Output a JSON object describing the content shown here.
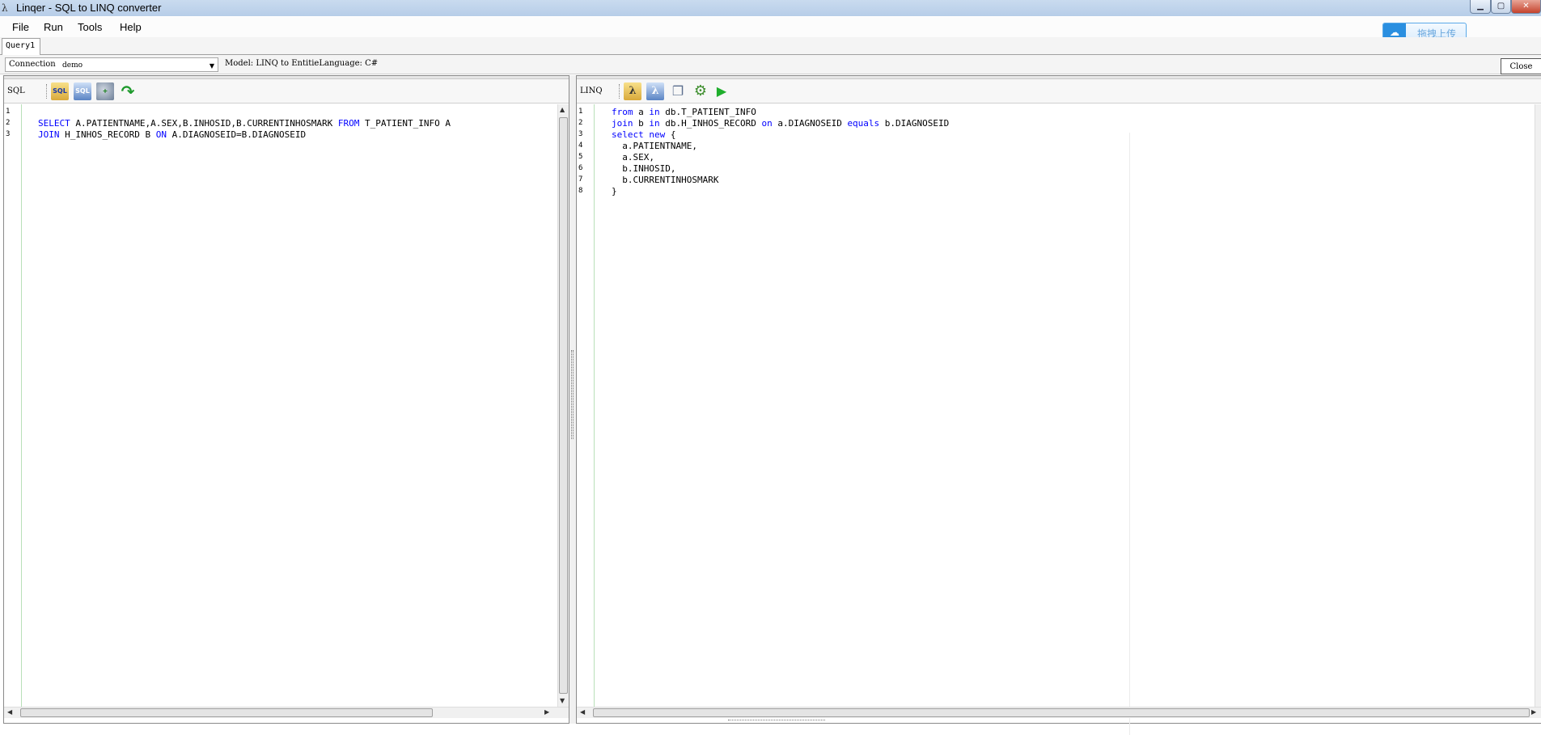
{
  "window": {
    "title": "Linqer - SQL to LINQ converter",
    "min_glyph": "▁",
    "max_glyph": "▢",
    "close_glyph": "✕"
  },
  "menu": [
    "File",
    "Run",
    "Tools",
    "Help"
  ],
  "upload_button": {
    "label": "拖拽上传"
  },
  "tabs": [
    "Query1"
  ],
  "connection": {
    "label": "Connection",
    "value": "demo"
  },
  "model_info": "Model: LINQ to EntitieLanguage: C#",
  "close_label": "Close",
  "sql_pane": {
    "caption": "SQL",
    "line_numbers": [
      "1",
      "2",
      "3"
    ],
    "lines": [
      [],
      [
        {
          "t": "SELECT",
          "kw": true
        },
        {
          "t": " A.PATIENTNAME,A.SEX,B.INHOSID,B.CURRENTINHOSMARK ",
          "kw": false
        },
        {
          "t": "FROM",
          "kw": true
        },
        {
          "t": " T_PATIENT_INFO A",
          "kw": false
        }
      ],
      [
        {
          "t": "JOIN",
          "kw": true
        },
        {
          "t": " H_INHOS_RECORD B ",
          "kw": false
        },
        {
          "t": "ON",
          "kw": true
        },
        {
          "t": " A.DIAGNOSEID=B.DIAGNOSEID",
          "kw": false
        }
      ]
    ]
  },
  "linq_pane": {
    "caption": "LINQ",
    "line_numbers": [
      "1",
      "2",
      "3",
      "4",
      "5",
      "6",
      "7",
      "8"
    ],
    "lines": [
      [
        {
          "t": "from",
          "kw": true
        },
        {
          "t": " a ",
          "kw": false
        },
        {
          "t": "in",
          "kw": true
        },
        {
          "t": " db.T_PATIENT_INFO",
          "kw": false
        }
      ],
      [
        {
          "t": "join",
          "kw": true
        },
        {
          "t": " b ",
          "kw": false
        },
        {
          "t": "in",
          "kw": true
        },
        {
          "t": " db.H_INHOS_RECORD ",
          "kw": false
        },
        {
          "t": "on",
          "kw": true
        },
        {
          "t": " a.DIAGNOSEID ",
          "kw": false
        },
        {
          "t": "equals",
          "kw": true
        },
        {
          "t": " b.DIAGNOSEID",
          "kw": false
        }
      ],
      [
        {
          "t": "select",
          "kw": true
        },
        {
          "t": " ",
          "kw": false
        },
        {
          "t": "new",
          "kw": true
        },
        {
          "t": " {",
          "kw": false
        }
      ],
      [
        {
          "t": "  a.PATIENTNAME,",
          "kw": false
        }
      ],
      [
        {
          "t": "  a.SEX,",
          "kw": false
        }
      ],
      [
        {
          "t": "  b.INHOSID,",
          "kw": false
        }
      ],
      [
        {
          "t": "  b.CURRENTINHOSMARK",
          "kw": false
        }
      ],
      [
        {
          "t": "}",
          "kw": false
        }
      ]
    ]
  },
  "icons": {
    "sql_toolbar": [
      "open-sql-icon",
      "save-sql-icon",
      "database-add-icon",
      "redo-arrow-icon"
    ],
    "linq_toolbar": [
      "open-linq-icon",
      "save-linq-icon",
      "copy-icon",
      "settings-gears-icon",
      "run-icon"
    ]
  },
  "colors": {
    "keyword": "#0000ff",
    "text": "#000000",
    "gutter_line": "#b9e0b9"
  }
}
